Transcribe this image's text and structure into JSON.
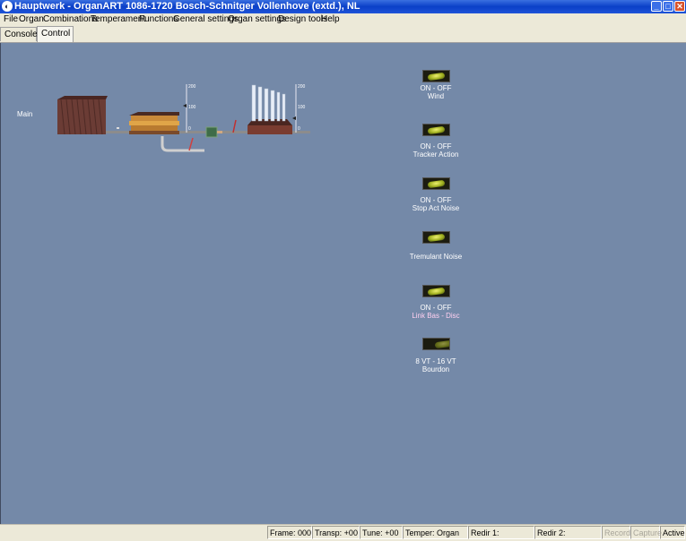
{
  "window": {
    "title": "Hauptwerk - OrganART 1086-1720 Bosch-Schnitger Vollenhove (extd.), NL",
    "app_icon": "hauptwerk-icon",
    "minimize": "_",
    "maximize": "□",
    "close": "✕"
  },
  "menu": [
    "File",
    "Organ",
    "Combinations",
    "Temperament",
    "Functions",
    "General settings",
    "Organ settings",
    "Design tools",
    "Help"
  ],
  "tabs": [
    {
      "label": "Console",
      "active": false
    },
    {
      "label": "Control",
      "active": true
    }
  ],
  "diagram": {
    "division_label": "Main",
    "gauge_left": {
      "max": "200",
      "mid": "100",
      "min": "0"
    },
    "gauge_right": {
      "max": "200",
      "mid": "100",
      "min": "0"
    }
  },
  "controls": [
    {
      "line1": "ON - OFF",
      "line2": "Wind",
      "state": "on"
    },
    {
      "line1": "ON - OFF",
      "line2": "Tracker Action",
      "state": "on"
    },
    {
      "line1": "ON - OFF",
      "line2": "Stop Act Noise",
      "state": "on"
    },
    {
      "line1": "",
      "line2": "Tremulant Noise",
      "state": "on"
    },
    {
      "line1": "ON - OFF",
      "line2": "Link Bas - Disc",
      "state": "on",
      "color": "#ffd0f0"
    },
    {
      "line1": "8 VT - 16 VT",
      "line2": "Bourdon",
      "state": "dim"
    }
  ],
  "status": {
    "frame": "Frame: 000",
    "transp": "Transp: +00",
    "tune": "Tune: +00",
    "temper": "Temper: Organ",
    "redir1": "Redir 1:",
    "redir2": "Redir 2:",
    "record": "Record",
    "capture": "Capture",
    "active": "Active"
  }
}
